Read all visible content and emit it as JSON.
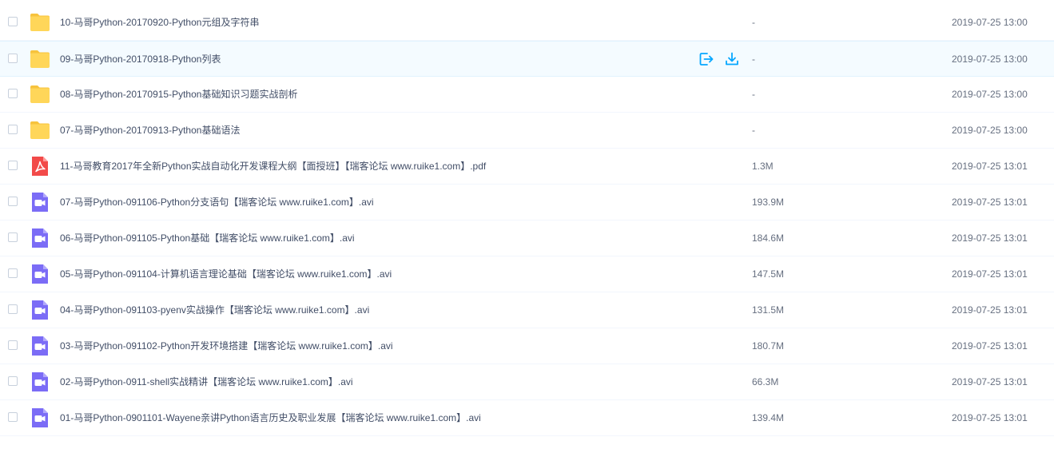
{
  "colors": {
    "folder": "#ffd659",
    "folder_tab": "#f7c33d",
    "pdf": "#f24a49",
    "video": "#7b6cf6",
    "action": "#06a7ff"
  },
  "actions": {
    "share_icon": "share-icon",
    "download_icon": "download-icon"
  },
  "files": [
    {
      "type": "folder",
      "name": "10-马哥Python-20170920-Python元组及字符串",
      "size": "-",
      "time": "2019-07-25 13:00"
    },
    {
      "type": "folder",
      "name": "09-马哥Python-20170918-Python列表",
      "size": "-",
      "time": "2019-07-25 13:00",
      "hovered": true
    },
    {
      "type": "folder",
      "name": "08-马哥Python-20170915-Python基础知识习题实战剖析",
      "size": "-",
      "time": "2019-07-25 13:00"
    },
    {
      "type": "folder",
      "name": "07-马哥Python-20170913-Python基础语法",
      "size": "-",
      "time": "2019-07-25 13:00"
    },
    {
      "type": "pdf",
      "name": "11-马哥教育2017年全新Python实战自动化开发课程大纲【面授班】【瑞客论坛 www.ruike1.com】.pdf",
      "size": "1.3M",
      "time": "2019-07-25 13:01"
    },
    {
      "type": "video",
      "name": "07-马哥Python-091106-Python分支语句【瑞客论坛 www.ruike1.com】.avi",
      "size": "193.9M",
      "time": "2019-07-25 13:01"
    },
    {
      "type": "video",
      "name": "06-马哥Python-091105-Python基础【瑞客论坛 www.ruike1.com】.avi",
      "size": "184.6M",
      "time": "2019-07-25 13:01"
    },
    {
      "type": "video",
      "name": "05-马哥Python-091104-计算机语言理论基础【瑞客论坛 www.ruike1.com】.avi",
      "size": "147.5M",
      "time": "2019-07-25 13:01"
    },
    {
      "type": "video",
      "name": "04-马哥Python-091103-pyenv实战操作【瑞客论坛 www.ruike1.com】.avi",
      "size": "131.5M",
      "time": "2019-07-25 13:01"
    },
    {
      "type": "video",
      "name": "03-马哥Python-091102-Python开发环境搭建【瑞客论坛 www.ruike1.com】.avi",
      "size": "180.7M",
      "time": "2019-07-25 13:01"
    },
    {
      "type": "video",
      "name": "02-马哥Python-0911-shell实战精讲【瑞客论坛 www.ruike1.com】.avi",
      "size": "66.3M",
      "time": "2019-07-25 13:01"
    },
    {
      "type": "video",
      "name": "01-马哥Python-0901101-Wayene亲讲Python语言历史及职业发展【瑞客论坛 www.ruike1.com】.avi",
      "size": "139.4M",
      "time": "2019-07-25 13:01"
    }
  ]
}
